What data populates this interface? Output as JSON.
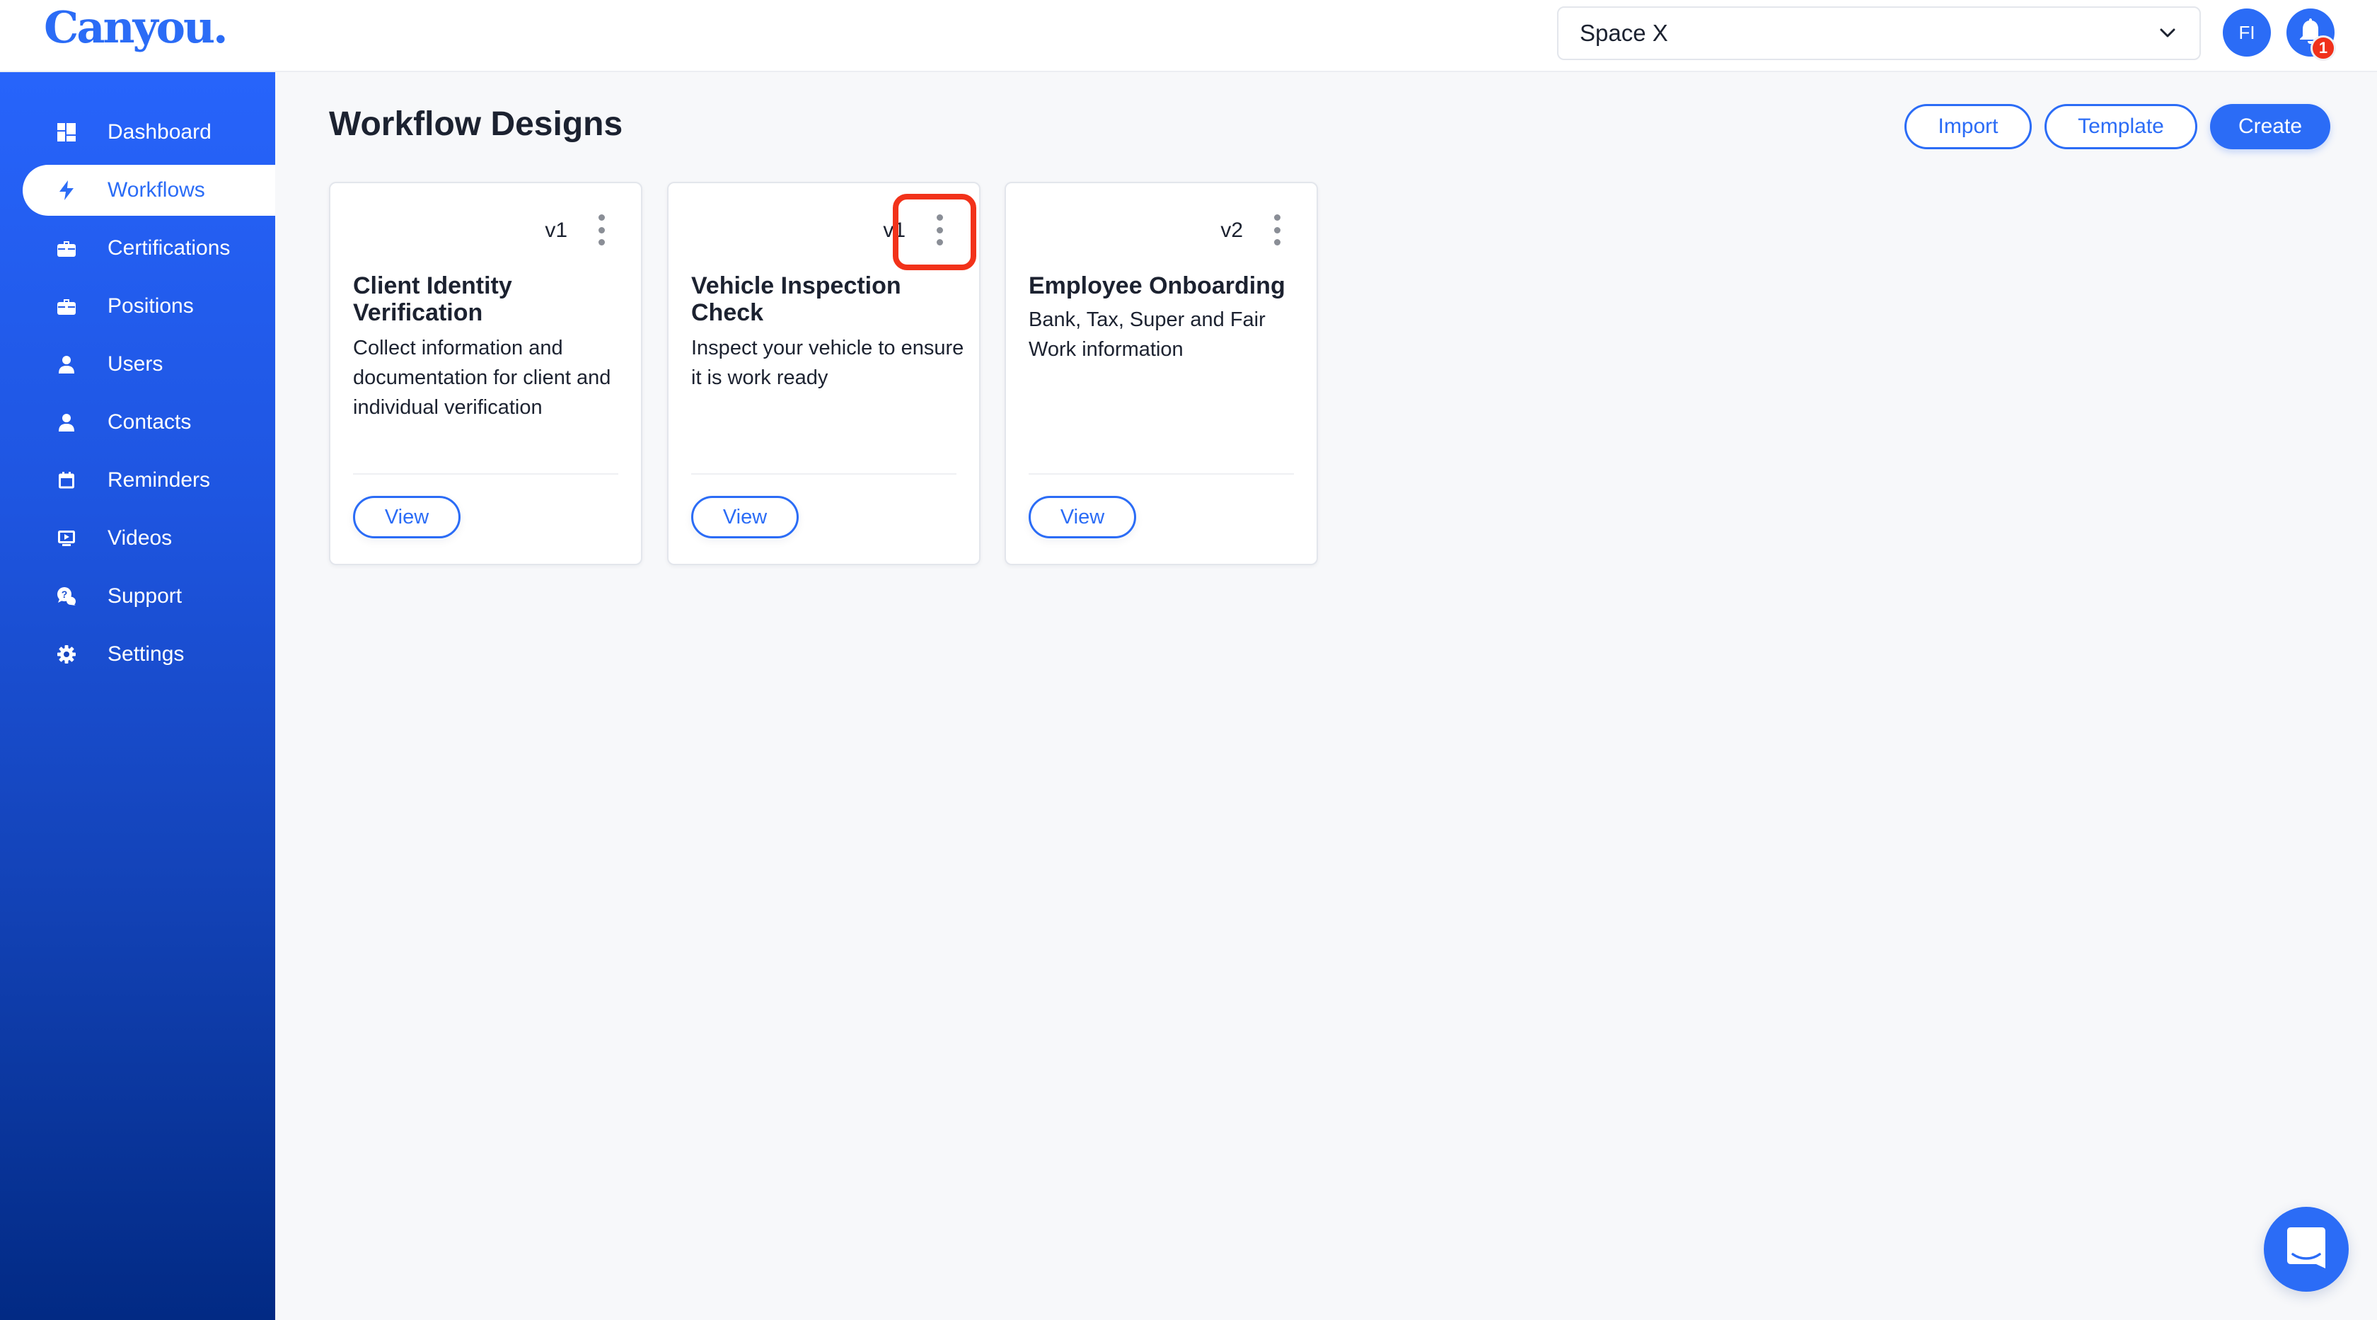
{
  "app": {
    "logo_text": "Canyou.",
    "brand_color": "#2b6cf6"
  },
  "header": {
    "space_select": {
      "value": "Space X",
      "icon": "chevron-down-icon"
    },
    "avatar_initials": "FI",
    "notifications": {
      "icon": "bell-icon",
      "count": "1"
    }
  },
  "sidebar": {
    "items": [
      {
        "label": "Dashboard",
        "icon": "dashboard-icon",
        "active": false
      },
      {
        "label": "Workflows",
        "icon": "lightning-icon",
        "active": true
      },
      {
        "label": "Certifications",
        "icon": "briefcase-icon",
        "active": false
      },
      {
        "label": "Positions",
        "icon": "briefcase-icon",
        "active": false
      },
      {
        "label": "Users",
        "icon": "user-icon",
        "active": false
      },
      {
        "label": "Contacts",
        "icon": "user-icon",
        "active": false
      },
      {
        "label": "Reminders",
        "icon": "calendar-icon",
        "active": false
      },
      {
        "label": "Videos",
        "icon": "video-icon",
        "active": false
      },
      {
        "label": "Support",
        "icon": "support-chat-icon",
        "active": false
      },
      {
        "label": "Settings",
        "icon": "gear-icon",
        "active": false
      }
    ]
  },
  "main": {
    "title": "Workflow Designs",
    "actions": {
      "import_label": "Import",
      "template_label": "Template",
      "create_label": "Create"
    },
    "cards": [
      {
        "version": "v1",
        "title": "Client Identity Verification",
        "description": "Collect information and documentation for client and individual verification",
        "view_label": "View"
      },
      {
        "version": "v1",
        "title": "Vehicle Inspection Check",
        "description": "Inspect your vehicle to ensure it is work ready",
        "view_label": "View"
      },
      {
        "version": "v2",
        "title": "Employee Onboarding",
        "description": "Bank, Tax, Super and Fair Work information",
        "view_label": "View"
      }
    ]
  },
  "chat_widget": {
    "icon": "chat-icon"
  }
}
